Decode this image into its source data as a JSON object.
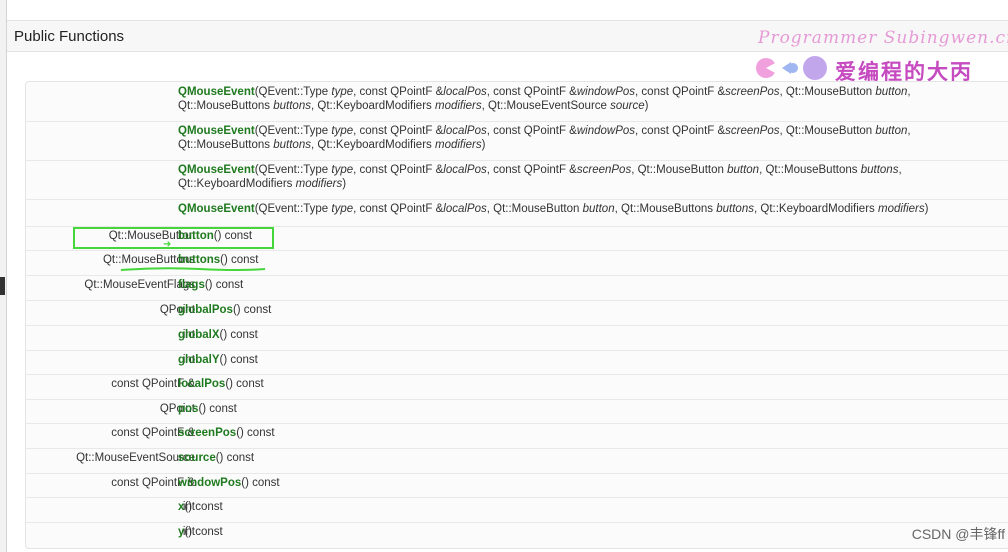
{
  "section_title": "Public Functions",
  "watermark": {
    "latin": "Programmer Subingwen.cn",
    "chinese": "爱编程的大丙"
  },
  "footer_credit": "CSDN @丰锋ff",
  "colors": {
    "function_name": "#1f7a1f",
    "highlight": "#44d63a",
    "watermark_pink": "#e59ad6",
    "watermark_purple": "#c64ac0"
  },
  "rows": [
    {
      "ret": "",
      "segments": [
        {
          "t": "QMouseEvent",
          "s": "fn"
        },
        {
          "t": "(QEvent::Type "
        },
        {
          "t": "type",
          "s": "i"
        },
        {
          "t": ", const QPointF &"
        },
        {
          "t": "localPos",
          "s": "i"
        },
        {
          "t": ", const QPointF &"
        },
        {
          "t": "windowPos",
          "s": "i"
        },
        {
          "t": ", const QPointF &"
        },
        {
          "t": "screenPos",
          "s": "i"
        },
        {
          "t": ", Qt::MouseButton "
        },
        {
          "t": "button",
          "s": "i"
        },
        {
          "t": ", Qt::MouseButtons "
        },
        {
          "t": "buttons",
          "s": "i"
        },
        {
          "t": ", Qt::KeyboardModifiers "
        },
        {
          "t": "modifiers",
          "s": "i"
        },
        {
          "t": ", Qt::MouseEventSource "
        },
        {
          "t": "source",
          "s": "i"
        },
        {
          "t": ")"
        }
      ]
    },
    {
      "ret": "",
      "segments": [
        {
          "t": "QMouseEvent",
          "s": "fn"
        },
        {
          "t": "(QEvent::Type "
        },
        {
          "t": "type",
          "s": "i"
        },
        {
          "t": ", const QPointF &"
        },
        {
          "t": "localPos",
          "s": "i"
        },
        {
          "t": ", const QPointF &"
        },
        {
          "t": "windowPos",
          "s": "i"
        },
        {
          "t": ", const QPointF &"
        },
        {
          "t": "screenPos",
          "s": "i"
        },
        {
          "t": ", Qt::MouseButton "
        },
        {
          "t": "button",
          "s": "i"
        },
        {
          "t": ", Qt::MouseButtons "
        },
        {
          "t": "buttons",
          "s": "i"
        },
        {
          "t": ", Qt::KeyboardModifiers "
        },
        {
          "t": "modifiers",
          "s": "i"
        },
        {
          "t": ")"
        }
      ]
    },
    {
      "ret": "",
      "segments": [
        {
          "t": "QMouseEvent",
          "s": "fn"
        },
        {
          "t": "(QEvent::Type "
        },
        {
          "t": "type",
          "s": "i"
        },
        {
          "t": ", const QPointF &"
        },
        {
          "t": "localPos",
          "s": "i"
        },
        {
          "t": ", const QPointF &"
        },
        {
          "t": "screenPos",
          "s": "i"
        },
        {
          "t": ", Qt::MouseButton "
        },
        {
          "t": "button",
          "s": "i"
        },
        {
          "t": ", Qt::MouseButtons "
        },
        {
          "t": "buttons",
          "s": "i"
        },
        {
          "t": ", Qt::KeyboardModifiers "
        },
        {
          "t": "modifiers",
          "s": "i"
        },
        {
          "t": ")"
        }
      ]
    },
    {
      "ret": "",
      "segments": [
        {
          "t": "QMouseEvent",
          "s": "fn"
        },
        {
          "t": "(QEvent::Type "
        },
        {
          "t": "type",
          "s": "i"
        },
        {
          "t": ", const QPointF &"
        },
        {
          "t": "localPos",
          "s": "i"
        },
        {
          "t": ", Qt::MouseButton "
        },
        {
          "t": "button",
          "s": "i"
        },
        {
          "t": ", Qt::MouseButtons "
        },
        {
          "t": "buttons",
          "s": "i"
        },
        {
          "t": ", Qt::KeyboardModifiers "
        },
        {
          "t": "modifiers",
          "s": "i"
        },
        {
          "t": ")"
        }
      ]
    },
    {
      "ret": "Qt::MouseButton",
      "segments": [
        {
          "t": "button",
          "s": "fn"
        },
        {
          "t": "() const"
        }
      ]
    },
    {
      "ret": "Qt::MouseButtons",
      "segments": [
        {
          "t": "buttons",
          "s": "fn"
        },
        {
          "t": "() const"
        }
      ]
    },
    {
      "ret": "Qt::MouseEventFlags",
      "segments": [
        {
          "t": "flags",
          "s": "fn"
        },
        {
          "t": "() const"
        }
      ]
    },
    {
      "ret": "QPoint",
      "segments": [
        {
          "t": "globalPos",
          "s": "fn"
        },
        {
          "t": "() const"
        }
      ]
    },
    {
      "ret": "int",
      "segments": [
        {
          "t": "globalX",
          "s": "fn"
        },
        {
          "t": "() const"
        }
      ]
    },
    {
      "ret": "int",
      "segments": [
        {
          "t": "globalY",
          "s": "fn"
        },
        {
          "t": "() const"
        }
      ]
    },
    {
      "ret": "const QPointF &",
      "segments": [
        {
          "t": "localPos",
          "s": "fn"
        },
        {
          "t": "() const"
        }
      ]
    },
    {
      "ret": "QPoint",
      "segments": [
        {
          "t": "pos",
          "s": "fn"
        },
        {
          "t": "() const"
        }
      ]
    },
    {
      "ret": "const QPointF &",
      "segments": [
        {
          "t": "screenPos",
          "s": "fn"
        },
        {
          "t": "() const"
        }
      ]
    },
    {
      "ret": "Qt::MouseEventSource",
      "segments": [
        {
          "t": "source",
          "s": "fn"
        },
        {
          "t": "() const"
        }
      ]
    },
    {
      "ret": "const QPointF &",
      "segments": [
        {
          "t": "windowPos",
          "s": "fn"
        },
        {
          "t": "() const"
        }
      ]
    },
    {
      "ret": "int",
      "segments": [
        {
          "t": "x",
          "s": "fn"
        },
        {
          "t": "() const"
        }
      ]
    },
    {
      "ret": "int",
      "segments": [
        {
          "t": "y",
          "s": "fn"
        },
        {
          "t": "() const"
        }
      ]
    }
  ]
}
